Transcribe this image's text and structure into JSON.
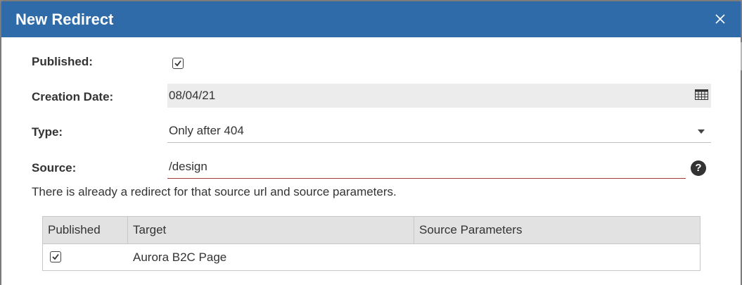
{
  "dialog": {
    "title": "New Redirect",
    "close_icon": "close-icon"
  },
  "form": {
    "published_label": "Published:",
    "published_checked": true,
    "creation_date_label": "Creation Date:",
    "creation_date_value": "08/04/21",
    "type_label": "Type:",
    "type_value": "Only after 404",
    "source_label": "Source:",
    "source_value": "/design",
    "help_glyph": "?"
  },
  "warning": "There is already a redirect for that source url and source parameters.",
  "table": {
    "columns": [
      "Published",
      "Target",
      "Source Parameters"
    ],
    "rows": [
      {
        "published": true,
        "target": "Aurora B2C Page",
        "source_parameters": ""
      }
    ]
  },
  "colors": {
    "titlebar": "#2f6ba8",
    "error_underline": "#a33a3a"
  }
}
